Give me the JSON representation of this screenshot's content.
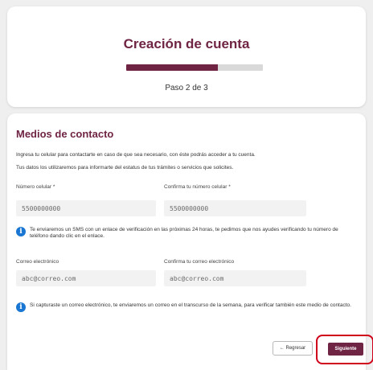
{
  "header": {
    "title": "Creación de cuenta",
    "step": "Paso 2 de 3",
    "progress": 0.67
  },
  "contact": {
    "section_title": "Medios de contacto",
    "desc1": "Ingresa tu celular para contactarte en caso de que sea necesario, con éste podrás acceder a tu cuenta.",
    "desc2": "Tus datos los utilizaremos para informarte del estatus de tus trámites o servicios que solicites.",
    "phone_label": "Número celular *",
    "phone_value": "5500000000",
    "phone_confirm_label": "Confirma tu número celular *",
    "phone_confirm_value": "5500000000",
    "sms_info": "Te enviaremos un SMS con un enlace de verificación en las próximas 24 horas, te pedimos que nos ayudes verificando tu número de teléfono dando clic en el enlace.",
    "email_label": "Correo electrónico",
    "email_value": "abc@correo.com",
    "email_confirm_label": "Confirma tu correo electrónico",
    "email_confirm_value": "abc@correo.com",
    "email_info": "Si capturaste un correo electrónico, te enviaremos un correo en el transcurso de la semana, para verificar también este medio de contacto."
  },
  "actions": {
    "back_label": "← Regresar",
    "next_label": "Siguiente"
  },
  "colors": {
    "brand": "#6f2443",
    "info": "#1976d2",
    "highlight": "#d0001a"
  },
  "icons": {
    "info": "info-icon"
  }
}
